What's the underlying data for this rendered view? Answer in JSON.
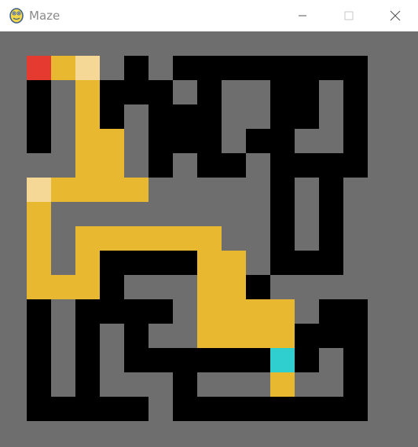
{
  "window": {
    "title": "Maze",
    "app_icon": "pygame-snake-icon",
    "controls": [
      "minimize-icon",
      "maximize-icon",
      "close-icon"
    ]
  },
  "colors": {
    "background": "#6e6e6e",
    "wall": "#000000",
    "path": "#e8b830",
    "visited_highlight": "#f5d896",
    "start": "#e53a30",
    "goal": "#2fcfcf",
    "titlebar": "#ffffff"
  },
  "maze": {
    "rows": 15,
    "cols": 15,
    "walls": [
      [
        1,
        5,
        5
      ],
      [
        1,
        7,
        14
      ],
      [
        2,
        1,
        1
      ],
      [
        2,
        3,
        6
      ],
      [
        2,
        8,
        8
      ],
      [
        2,
        11,
        12
      ],
      [
        2,
        14,
        14
      ],
      [
        3,
        1,
        1
      ],
      [
        3,
        3,
        4
      ],
      [
        3,
        6,
        8
      ],
      [
        3,
        11,
        12
      ],
      [
        3,
        14,
        14
      ],
      [
        4,
        1,
        1
      ],
      [
        4,
        3,
        4
      ],
      [
        4,
        6,
        8
      ],
      [
        4,
        10,
        11
      ],
      [
        4,
        14,
        14
      ],
      [
        5,
        3,
        4
      ],
      [
        5,
        6,
        6
      ],
      [
        5,
        8,
        9
      ],
      [
        5,
        11,
        14
      ],
      [
        6,
        11,
        11
      ],
      [
        6,
        13,
        13
      ],
      [
        7,
        11,
        11
      ],
      [
        7,
        13,
        13
      ],
      [
        8,
        11,
        11
      ],
      [
        8,
        13,
        13
      ],
      [
        9,
        4,
        7
      ],
      [
        9,
        11,
        13
      ],
      [
        10,
        4,
        4
      ],
      [
        10,
        9,
        10
      ],
      [
        11,
        1,
        1
      ],
      [
        11,
        3,
        5
      ],
      [
        11,
        6,
        6
      ],
      [
        11,
        8,
        8
      ],
      [
        11,
        9,
        10
      ],
      [
        11,
        13,
        14
      ],
      [
        12,
        1,
        1
      ],
      [
        12,
        3,
        3
      ],
      [
        12,
        5,
        5
      ],
      [
        12,
        11,
        12
      ],
      [
        12,
        13,
        14
      ],
      [
        13,
        1,
        1
      ],
      [
        13,
        3,
        3
      ],
      [
        13,
        5,
        10
      ],
      [
        13,
        12,
        12
      ],
      [
        13,
        14,
        14
      ],
      [
        14,
        1,
        1
      ],
      [
        14,
        3,
        3
      ],
      [
        14,
        7,
        7
      ],
      [
        14,
        14,
        14
      ],
      [
        15,
        1,
        5
      ],
      [
        15,
        7,
        14
      ]
    ],
    "path_cells": [
      [
        1,
        2
      ],
      [
        2,
        3
      ],
      [
        3,
        3
      ],
      [
        4,
        3
      ],
      [
        4,
        4
      ],
      [
        5,
        3
      ],
      [
        5,
        4
      ],
      [
        6,
        1
      ],
      [
        6,
        2
      ],
      [
        6,
        3
      ],
      [
        6,
        4
      ],
      [
        6,
        5
      ],
      [
        7,
        1
      ],
      [
        8,
        1
      ],
      [
        8,
        3
      ],
      [
        8,
        4
      ],
      [
        8,
        5
      ],
      [
        8,
        6
      ],
      [
        8,
        7
      ],
      [
        8,
        8
      ],
      [
        9,
        1
      ],
      [
        9,
        3
      ],
      [
        9,
        8
      ],
      [
        10,
        1
      ],
      [
        10,
        2
      ],
      [
        10,
        3
      ],
      [
        10,
        8
      ],
      [
        11,
        8
      ],
      [
        12,
        9
      ],
      [
        12,
        10
      ],
      [
        12,
        11
      ],
      [
        13,
        11
      ],
      [
        14,
        11
      ],
      [
        9,
        9
      ],
      [
        10,
        9
      ],
      [
        11,
        9
      ],
      [
        11,
        10
      ],
      [
        11,
        11
      ],
      [
        12,
        8
      ]
    ],
    "highlight_cells": [
      [
        1,
        3
      ],
      [
        6,
        1
      ]
    ],
    "start_cell": [
      1,
      1
    ],
    "goal_cell": [
      13,
      11
    ]
  }
}
